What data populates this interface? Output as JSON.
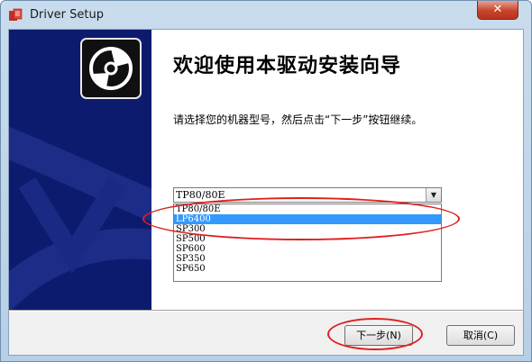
{
  "window": {
    "title": "Driver Setup",
    "close_label": "✕"
  },
  "wizard": {
    "heading": "欢迎使用本驱动安装向导",
    "instruction": "请选择您的机器型号，然后点击“下一步”按钮继续。"
  },
  "model_select": {
    "selected": "TP80/80E",
    "options": [
      "TP80/80E",
      "LP6400",
      "SP300",
      "SP500",
      "SP600",
      "SP350",
      "SP650"
    ],
    "highlighted_index": 1
  },
  "buttons": {
    "next": "下一步(N)",
    "cancel": "取消(C)"
  },
  "colors": {
    "banner": "#0d1b6f",
    "highlight": "#3399ff",
    "annotation": "#e02020"
  }
}
